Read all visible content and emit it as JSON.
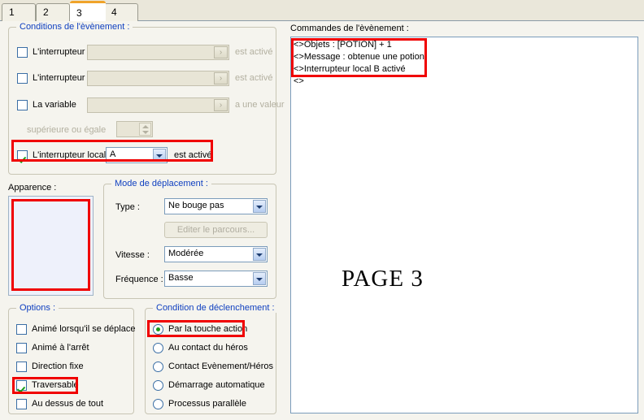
{
  "tabs": [
    {
      "label": "1",
      "active": false
    },
    {
      "label": "2",
      "active": false
    },
    {
      "label": "3",
      "active": true
    },
    {
      "label": "4",
      "active": false
    }
  ],
  "conditions": {
    "legend": "Conditions de l'èvènement :",
    "rows": [
      {
        "label": "L'interrupteur",
        "value": "",
        "suffix": "est activé",
        "checked": false
      },
      {
        "label": "L'interrupteur",
        "value": "",
        "suffix": "est activé",
        "checked": false
      },
      {
        "label": "La variable",
        "value": "",
        "suffix": "a une valeur",
        "checked": false
      }
    ],
    "comparison_label": "supérieure ou égale",
    "comparison_value": "",
    "local_switch": {
      "label": "L'interrupteur local",
      "value": "A",
      "suffix": "est activé",
      "checked": true
    },
    "go_button_glyph": "›"
  },
  "apparence": {
    "label": "Apparence :"
  },
  "movement": {
    "legend": "Mode de déplacement :",
    "type_label": "Type :",
    "type_value": "Ne bouge pas",
    "edit_path_button": "Editer le parcours...",
    "speed_label": "Vitesse :",
    "speed_value": "Modérée",
    "frequency_label": "Fréquence :",
    "frequency_value": "Basse"
  },
  "options": {
    "legend": "Options :",
    "items": [
      {
        "label": "Animé lorsqu'il se déplace",
        "checked": false
      },
      {
        "label": "Animé à l'arrêt",
        "checked": false
      },
      {
        "label": "Direction fixe",
        "checked": false
      },
      {
        "label": "Traversable",
        "checked": true
      },
      {
        "label": "Au dessus de tout",
        "checked": false
      }
    ]
  },
  "trigger": {
    "legend": "Condition de déclenchement :",
    "items": [
      {
        "label": "Par la touche action",
        "checked": true
      },
      {
        "label": "Au contact du héros",
        "checked": false
      },
      {
        "label": "Contact Evènement/Héros",
        "checked": false
      },
      {
        "label": "Démarrage automatique",
        "checked": false
      },
      {
        "label": "Processus parallèle",
        "checked": false
      }
    ]
  },
  "commands": {
    "label": "Commandes de l'èvènement :",
    "lines": [
      "<>Objets : [POTION] + 1",
      "<>Message : obtenue une potion",
      "<>Interrupteur local B activé",
      "<>"
    ],
    "page_label": "PAGE 3"
  },
  "colors": {
    "annotation": "#f00000",
    "legend_text": "#1040c0",
    "tab_active_accent": "#f0a32a",
    "background": "#f5f4ee",
    "tabstrip_background": "#eae7da"
  }
}
